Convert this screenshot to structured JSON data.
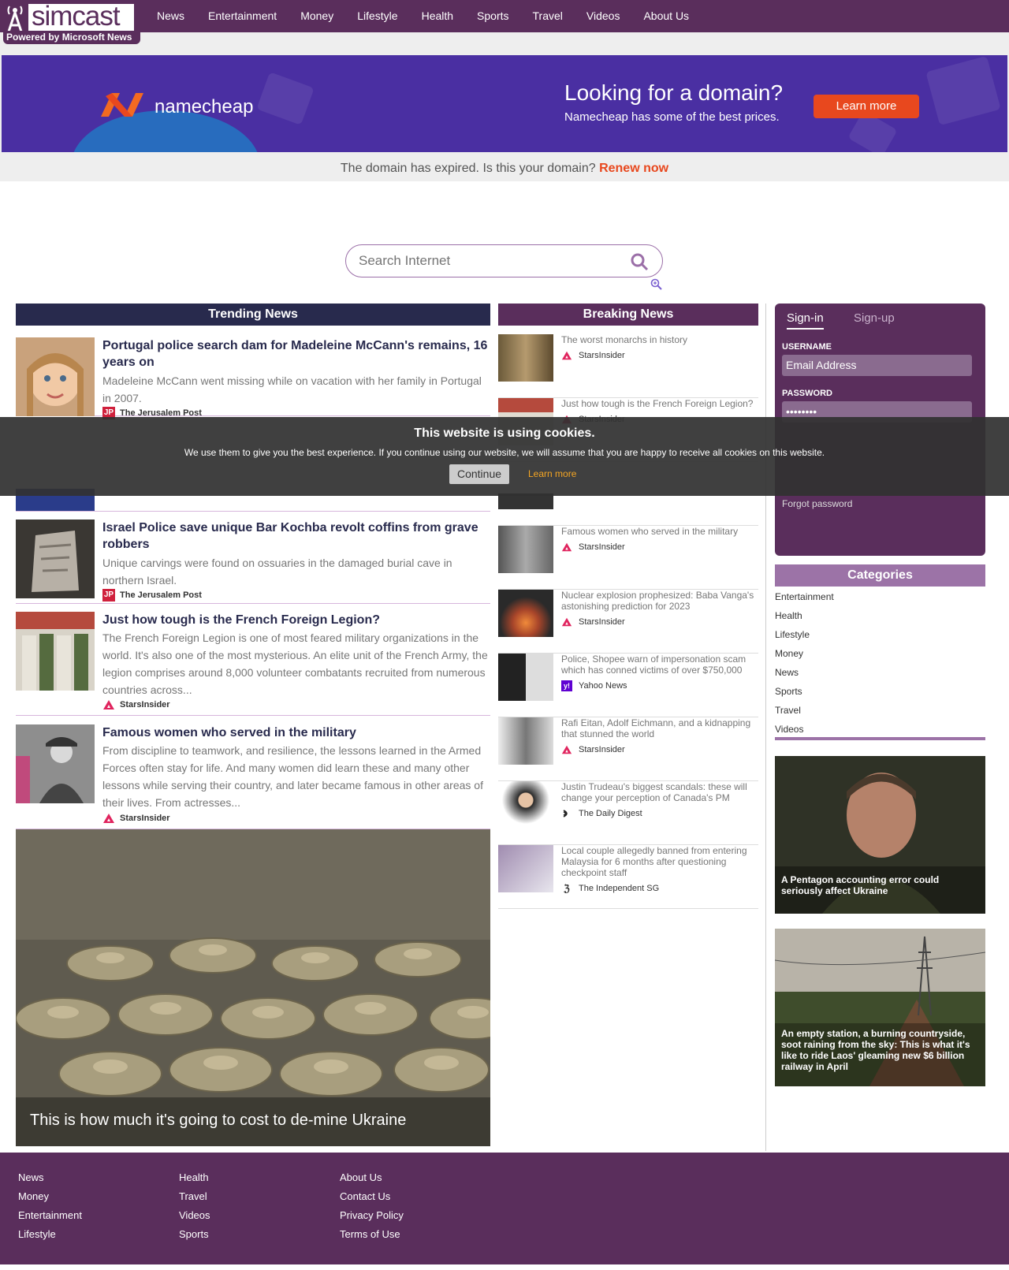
{
  "brand": {
    "name": "simcast",
    "powered": "Powered by Microsoft News"
  },
  "nav": [
    "News",
    "Entertainment",
    "Money",
    "Lifestyle",
    "Health",
    "Sports",
    "Travel",
    "Videos",
    "About Us"
  ],
  "ad": {
    "brand": "namecheap",
    "headline": "Looking for a domain?",
    "sub": "Namecheap has some of the best prices.",
    "button": "Learn more"
  },
  "expired": {
    "text": "The domain has expired. Is this your domain?",
    "link": "Renew now"
  },
  "search": {
    "placeholder": "Search Internet"
  },
  "trending": {
    "title": "Trending News",
    "items": [
      {
        "title": "Portugal police search dam for Madeleine McCann's remains, 16 years on",
        "desc": "Madeleine McCann went missing while on vacation with her family in Portugal in 2007.",
        "source": "The Jerusalem Post"
      },
      {
        "title": "Israel Police save unique Bar Kochba revolt coffins from grave robbers",
        "desc": "Unique carvings were found on ossuaries in the damaged burial cave in northern Israel.",
        "source": "The Jerusalem Post"
      },
      {
        "title": "Just how tough is the French Foreign Legion?",
        "desc": "The French Foreign Legion is one of most feared military organizations in the world. It's also one of the most mysterious. An elite unit of the French Army, the legion comprises around 8,000 volunteer combatants recruited from numerous countries across...",
        "source": "StarsInsider"
      },
      {
        "title": "Famous women who served in the military",
        "desc": "From discipline to teamwork, and resilience, the lessons learned in the Armed Forces often stay for life. And many women did learn these and many other lessons while serving their country, and later became famous in other areas of their lives. From actresses...",
        "source": "StarsInsider"
      }
    ],
    "feature": "This is how much it's going to cost to de-mine Ukraine"
  },
  "breaking": {
    "title": "Breaking News",
    "items": [
      {
        "title": "The worst monarchs in history",
        "source": "StarsInsider"
      },
      {
        "title": "Just how tough is the French Foreign Legion?",
        "source": "StarsInsider"
      },
      {
        "title": "",
        "source": ""
      },
      {
        "title": "Famous women who served in the military",
        "source": "StarsInsider"
      },
      {
        "title": "Nuclear explosion prophesized: Baba Vanga's astonishing prediction for 2023",
        "source": "StarsInsider"
      },
      {
        "title": "Police, Shopee warn of impersonation scam which has conned victims of over $750,000",
        "source": "Yahoo News"
      },
      {
        "title": "Rafi Eitan, Adolf Eichmann, and a kidnapping that stunned the world",
        "source": "StarsInsider"
      },
      {
        "title": "Justin Trudeau's biggest scandals: these will change your perception of Canada's PM",
        "source": "The Daily Digest"
      },
      {
        "title": "Local couple allegedly banned from entering Malaysia for 6 months after questioning checkpoint staff",
        "source": "The Independent SG"
      }
    ]
  },
  "login": {
    "signin": "Sign-in",
    "signup": "Sign-up",
    "username_label": "USERNAME",
    "username_placeholder": "Email Address",
    "password_label": "PASSWORD",
    "password_value": "••••••••",
    "forgot": "Forgot password"
  },
  "categories": {
    "title": "Categories",
    "items": [
      "Entertainment",
      "Health",
      "Lifestyle",
      "Money",
      "News",
      "Sports",
      "Travel",
      "Videos"
    ]
  },
  "side": [
    "A Pentagon accounting error could seriously affect Ukraine",
    "An empty station, a burning countryside, soot raining from the sky: This is what it's like to ride Laos' gleaming new $6 billion railway in April"
  ],
  "cookie": {
    "title": "This website is using cookies.",
    "text": "We use them to give you the best experience. If you continue using our website, we will assume that you are happy to receive all cookies on this website.",
    "continue": "Continue",
    "learn": "Learn more"
  },
  "footer": [
    [
      "News",
      "Money",
      "Entertainment",
      "Lifestyle"
    ],
    [
      "Health",
      "Travel",
      "Videos",
      "Sports"
    ],
    [
      "About Us",
      "Contact Us",
      "Privacy Policy",
      "Terms of Use"
    ]
  ],
  "colors": {
    "brand": "#5a2e5c",
    "trending": "#282a4d",
    "accent": "#e8481e",
    "category": "#9c73a7"
  }
}
